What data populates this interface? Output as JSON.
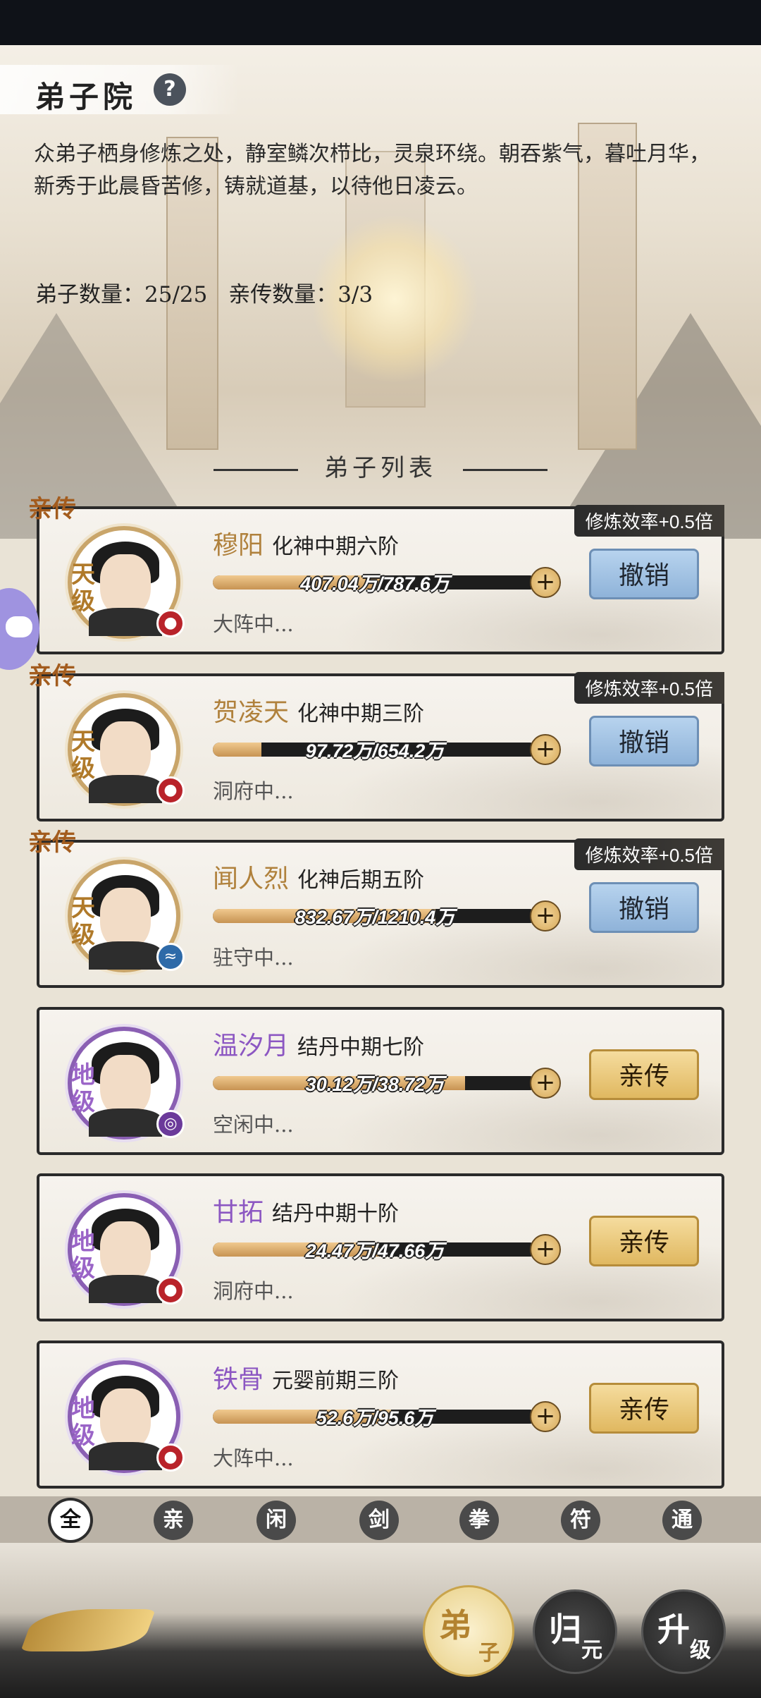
{
  "page": {
    "title": "弟子院",
    "help_icon": "?",
    "description": "众弟子栖身修炼之处，静室鳞次栉比，灵泉环绕。朝吞紫气，暮吐月华，新秀于此晨昏苦修，铸就道基，以待他日凌云。",
    "disciple_count": "弟子数量：25/25",
    "inner_count": "亲传数量：3/3",
    "list_title": "弟子列表"
  },
  "tags": {
    "inner_tag": "亲传"
  },
  "disciples": [
    {
      "name": "穆阳",
      "realm": "化神中期六阶",
      "progress_text": "407.04万/787.6万",
      "progress": 0.517,
      "status": "大阵中...",
      "grade": "天级",
      "element": "fire",
      "rate": "修炼效率+0.5倍",
      "button": "撤销",
      "inner": true
    },
    {
      "name": "贺凌天",
      "realm": "化神中期三阶",
      "progress_text": "97.72万/654.2万",
      "progress": 0.149,
      "status": "洞府中...",
      "grade": "天级",
      "element": "fire",
      "rate": "修炼效率+0.5倍",
      "button": "撤销",
      "inner": true
    },
    {
      "name": "闻人烈",
      "realm": "化神后期五阶",
      "progress_text": "832.67万/1210.4万",
      "progress": 0.688,
      "status": "驻守中...",
      "grade": "天级",
      "element": "water",
      "rate": "修炼效率+0.5倍",
      "button": "撤销",
      "inner": true
    },
    {
      "name": "温汐月",
      "realm": "结丹中期七阶",
      "progress_text": "30.12万/38.72万",
      "progress": 0.778,
      "status": "空闲中...",
      "grade": "地级",
      "element": "wind",
      "rate": "",
      "button": "亲传",
      "inner": false
    },
    {
      "name": "甘拓",
      "realm": "结丹中期十阶",
      "progress_text": "24.47万/47.66万",
      "progress": 0.513,
      "status": "洞府中...",
      "grade": "地级",
      "element": "fire",
      "rate": "",
      "button": "亲传",
      "inner": false
    },
    {
      "name": "铁骨",
      "realm": "元婴前期三阶",
      "progress_text": "52.6万/95.6万",
      "progress": 0.55,
      "status": "大阵中...",
      "grade": "地级",
      "element": "fire",
      "rate": "",
      "button": "亲传",
      "inner": false
    }
  ],
  "filters": [
    "全",
    "亲",
    "闲",
    "剑",
    "拳",
    "符",
    "通"
  ],
  "bottom_nav": [
    {
      "big": "弟",
      "small": "子"
    },
    {
      "big": "归",
      "small": "元"
    },
    {
      "big": "升",
      "small": "级"
    }
  ],
  "colors": {
    "gold": "#b0813c",
    "purple": "#8c57c2",
    "revoke": "#8fb3d9",
    "promote": "#e0b860"
  },
  "icons": {
    "fire": "fire-element-icon",
    "water": "water-element-icon",
    "wind": "wind-element-icon",
    "floating": "gamepad-icon"
  }
}
